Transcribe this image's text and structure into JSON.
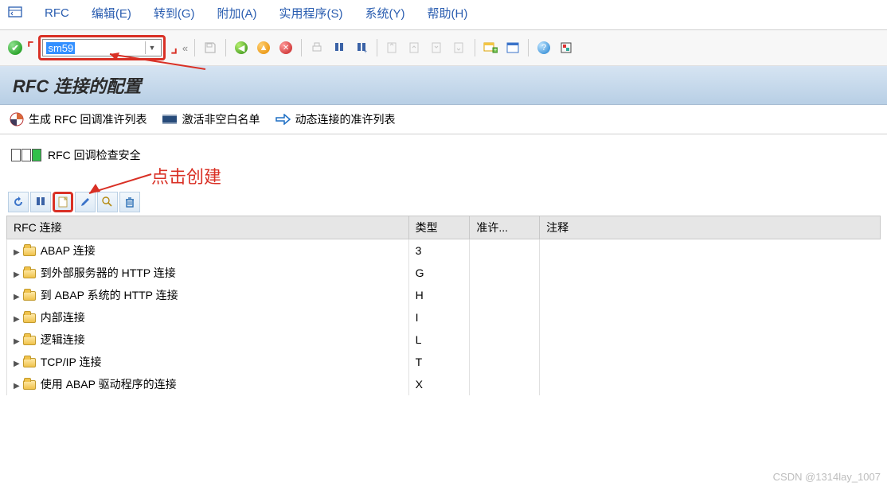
{
  "menu": {
    "icon_label": "menu-icon",
    "items": [
      "RFC",
      "编辑(E)",
      "转到(G)",
      "附加(A)",
      "实用程序(S)",
      "系统(Y)",
      "帮助(H)"
    ]
  },
  "toolbar": {
    "tcode_value": "sm59",
    "corner_tl": "⌜",
    "corner_br": "⌟",
    "back_label": "«"
  },
  "title": "RFC 连接的配置",
  "app_toolbar": {
    "generate": "生成 RFC 回调准许列表",
    "activate": "激活非空白名单",
    "dynamic": "动态连接的准许列表"
  },
  "status_text": "RFC 回调检查安全",
  "annotations": {
    "create_label": "点击创建"
  },
  "table": {
    "headers": [
      "RFC 连接",
      "类型",
      "准许...",
      "注释"
    ],
    "rows": [
      {
        "name": "ABAP 连接",
        "type": "3",
        "perm": "",
        "note": ""
      },
      {
        "name": "到外部服务器的 HTTP 连接",
        "type": "G",
        "perm": "",
        "note": ""
      },
      {
        "name": "到 ABAP 系统的 HTTP 连接",
        "type": "H",
        "perm": "",
        "note": ""
      },
      {
        "name": "内部连接",
        "type": "I",
        "perm": "",
        "note": ""
      },
      {
        "name": "逻辑连接",
        "type": "L",
        "perm": "",
        "note": ""
      },
      {
        "name": "TCP/IP 连接",
        "type": "T",
        "perm": "",
        "note": ""
      },
      {
        "name": "使用 ABAP 驱动程序的连接",
        "type": "X",
        "perm": "",
        "note": ""
      }
    ]
  },
  "watermark": "CSDN @1314lay_1007"
}
